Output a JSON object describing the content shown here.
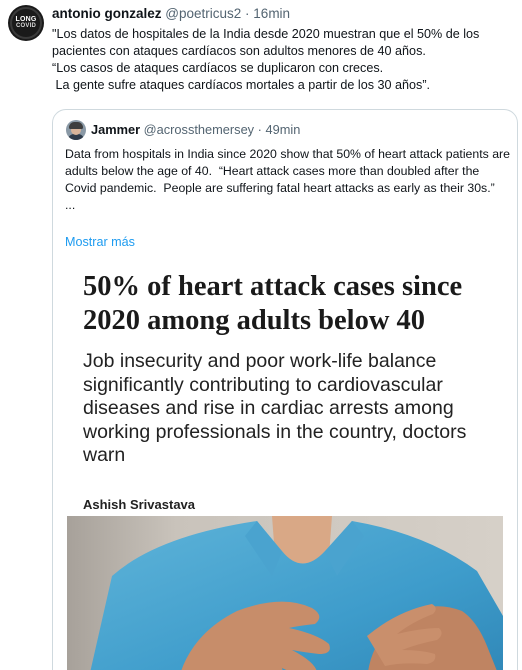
{
  "tweet": {
    "author_name": "antonio gonzalez",
    "author_handle": "@poetricus2",
    "separator": "·",
    "time": "16min",
    "avatar_text_1": "LONG",
    "avatar_text_2": "COVID",
    "text": "\"Los datos de hospitales de la India desde 2020 muestran que el 50% de los pacientes con ataques cardíacos son adultos menores de 40 años.\n“Los casos de ataques cardíacos se duplicaron con creces.\n La gente sufre ataques cardíacos mortales a partir de los 30 años”."
  },
  "quoted_tweet": {
    "author_name": "Jammer",
    "author_handle": "@acrossthemersey",
    "separator": "·",
    "time": "49min",
    "text": "Data from hospitals in India since 2020 show that 50% of heart attack patients are adults below the age of 40.  “Heart attack cases more than doubled after the Covid pandemic.  People are suffering fatal heart attacks as early as their 30s.”\n...",
    "show_more": "Mostrar más"
  },
  "article_image": {
    "headline": "50% of heart attack cases since 2020 among adults below 40",
    "subheadline": "Job insecurity and poor work-life balance significantly contributing to cardiovascular diseases and rise in cardiac arrests among working professionals in the country, doctors warn",
    "author": "Ashish Srivastava"
  }
}
